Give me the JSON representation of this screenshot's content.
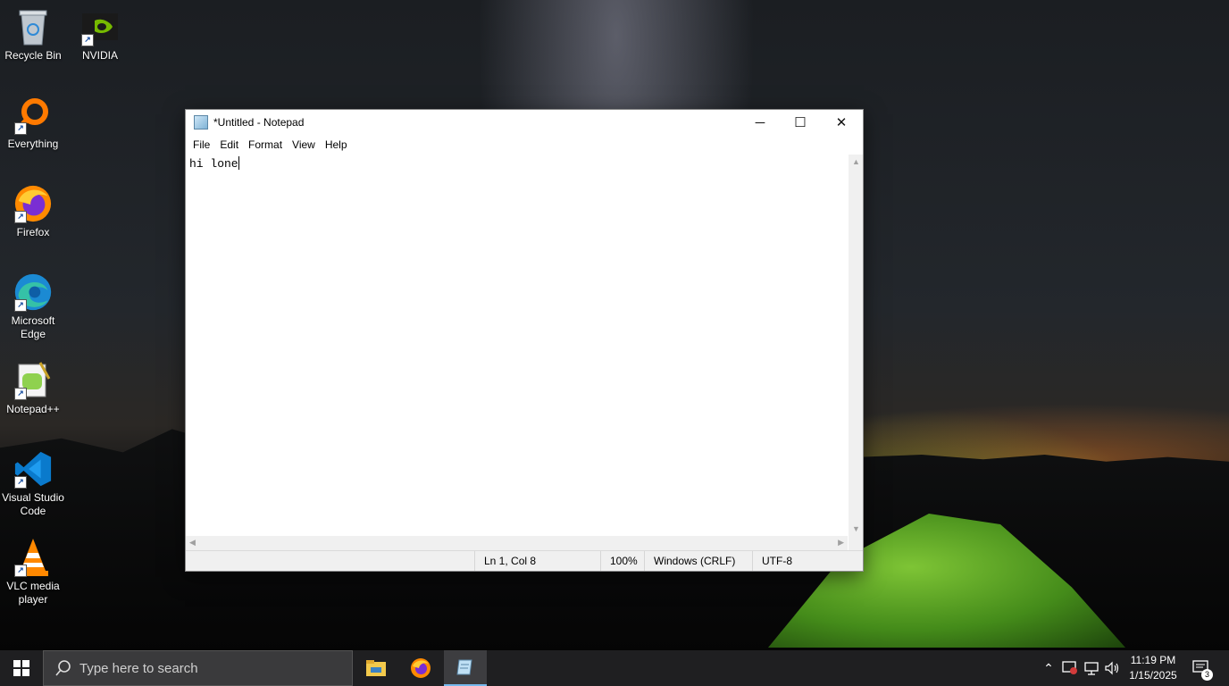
{
  "desktop": {
    "icons": [
      {
        "label": "Recycle Bin",
        "icon": "recycle-bin-icon"
      },
      {
        "label": "NVIDIA",
        "icon": "nvidia-icon"
      },
      {
        "label": "Everything",
        "icon": "everything-search-icon"
      },
      {
        "label": "Firefox",
        "icon": "firefox-icon"
      },
      {
        "label": "Microsoft Edge",
        "icon": "edge-icon"
      },
      {
        "label": "Notepad++",
        "icon": "notepad-plus-plus-icon"
      },
      {
        "label": "Visual Studio Code",
        "icon": "vscode-icon"
      },
      {
        "label": "VLC media player",
        "icon": "vlc-icon"
      }
    ]
  },
  "notepad": {
    "title": "*Untitled - Notepad",
    "menu": [
      "File",
      "Edit",
      "Format",
      "View",
      "Help"
    ],
    "content": "hi lone",
    "status": {
      "position": "Ln 1, Col 8",
      "zoom": "100%",
      "line_ending": "Windows (CRLF)",
      "encoding": "UTF-8"
    },
    "controls": {
      "minimize": "─",
      "maximize": "☐",
      "close": "✕"
    }
  },
  "taskbar": {
    "search_placeholder": "Type here to search",
    "apps": [
      "file-explorer-icon",
      "firefox-icon",
      "notepad-icon"
    ],
    "clock": {
      "time": "11:19 PM",
      "date": "1/15/2025"
    },
    "notifications_count": "3"
  }
}
